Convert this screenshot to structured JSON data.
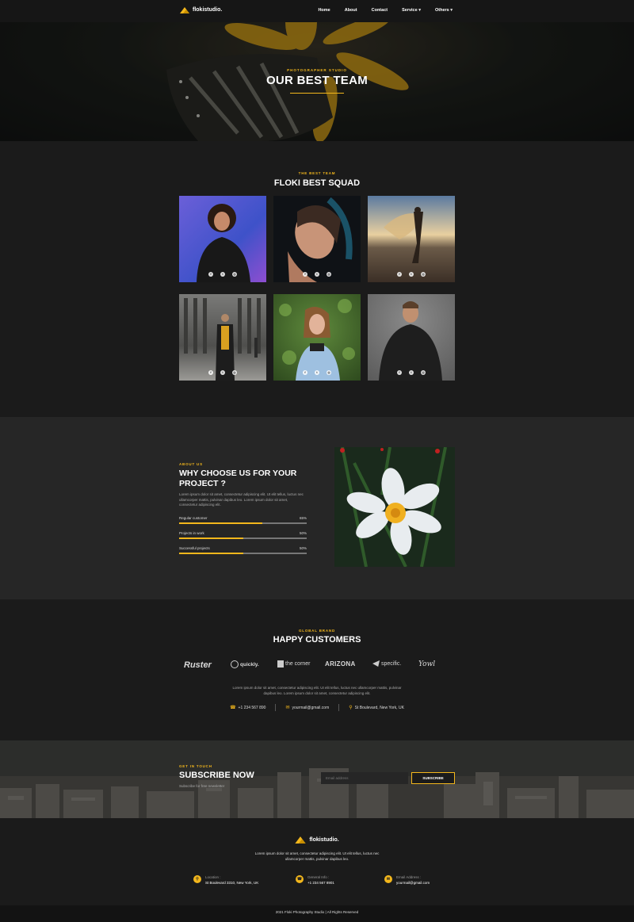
{
  "nav": {
    "logo_text": "flokistudio.",
    "items": [
      {
        "label": "Home",
        "dropdown": false
      },
      {
        "label": "About",
        "dropdown": false
      },
      {
        "label": "Contact",
        "dropdown": false
      },
      {
        "label": "Service",
        "dropdown": true
      },
      {
        "label": "Others",
        "dropdown": true
      }
    ]
  },
  "hero": {
    "subtitle": "PHOTOGRAPHER STUDIO",
    "title": "OUR BEST TEAM"
  },
  "team": {
    "eyebrow": "THE BEST TEAM",
    "title": "FLOKI BEST SQUAD",
    "social_icons": [
      "facebook-icon",
      "twitter-icon",
      "instagram-icon"
    ]
  },
  "about": {
    "eyebrow": "ABOUT US",
    "title_line1": "WHY CHOOSE US FOR YOUR",
    "title_line2": "PROJECT ?",
    "body": "Lorem ipsum dolor sit amet, consectetur adipiscing elit. Ut elit tellus, luctus nec ullamcorper mattis, pulvinar dapibus leo. Lorem ipsum dolor sit amet, consectetur adipiscing elit.",
    "progress": [
      {
        "label": "Regular customer",
        "percent_text": "65%",
        "value": 0.65
      },
      {
        "label": "Projects in work",
        "percent_text": "50%",
        "value": 0.5
      },
      {
        "label": "Successful projects",
        "percent_text": "50%",
        "value": 0.5
      }
    ]
  },
  "customers": {
    "eyebrow": "GLOBAL BRAND",
    "title": "HAPPY CUSTOMERS",
    "brands": [
      "Ruster",
      "quickly.",
      "the corner",
      "ARIZONA",
      "specific.",
      "Yowl"
    ],
    "body": "Lorem ipsum dolor sit amet, consectetur adipiscing elit. Ut elit tellus, luctus nec ullamcorper mattis, pulvinar dapibus leo. Lorem ipsum dolor sit amet, consectetur adipiscing elit.",
    "phone": "+1 234 567 890",
    "email": "yourmail@gmail.com",
    "address": "St Boulevard, New York, UK"
  },
  "subscribe": {
    "eyebrow": "GET IN TOUCH",
    "title": "SUBSCRIBE NOW",
    "subtitle": "Subscribe for free newsletter",
    "email_placeholder": "Email address",
    "button_label": "SUBSCRIBE"
  },
  "footer": {
    "logo_text": "flokistudio.",
    "body": "Lorem ipsum dolor sit amet, consectetur adipiscing elit. Ut elit tellus, luctus nec ullamcorper mattis, pulvinar dapibus leo.",
    "info": [
      {
        "label": "Location :",
        "value": "St Boulevard 3310, New York, UK",
        "icon": "location-icon"
      },
      {
        "label": "General Info :",
        "value": "+1 234 567 8901",
        "icon": "phone-icon"
      },
      {
        "label": "Email Address :",
        "value": "yourmail@gmail.com",
        "icon": "email-icon"
      }
    ],
    "copyright": "2021 Floki Photography Studio | All Rights Reserved"
  },
  "colors": {
    "accent": "#f3b71c",
    "background": "#1b1b1b",
    "section_alt": "#262626"
  }
}
